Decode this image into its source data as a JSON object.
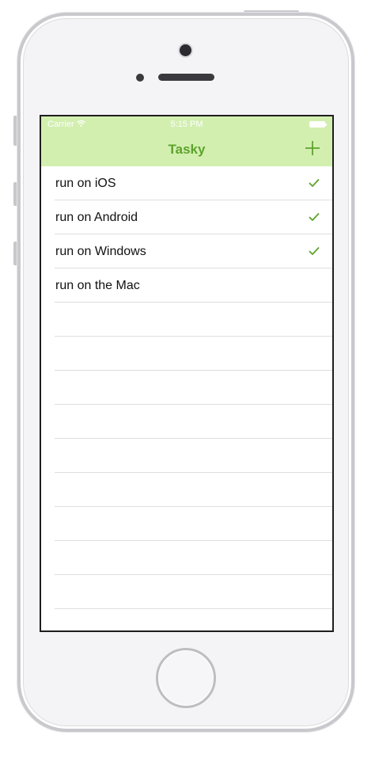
{
  "status_bar": {
    "carrier": "Carrier",
    "time": "5:15 PM"
  },
  "navbar": {
    "title": "Tasky",
    "add_icon": "plus-icon"
  },
  "colors": {
    "accent": "#5ea32c",
    "navbar_bg": "#d2efb0"
  },
  "tasks": [
    {
      "label": "run on iOS",
      "done": true
    },
    {
      "label": "run on Android",
      "done": true
    },
    {
      "label": "run on Windows",
      "done": true
    },
    {
      "label": "run on the Mac",
      "done": false
    }
  ],
  "empty_rows": 9
}
